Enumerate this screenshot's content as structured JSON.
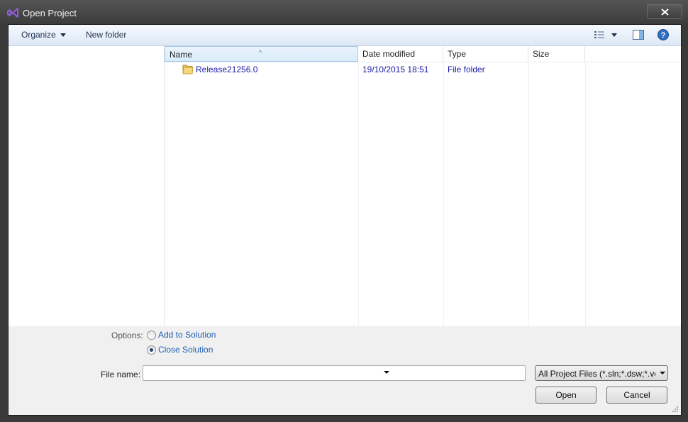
{
  "window": {
    "title": "Open Project",
    "accent": "#8855c8"
  },
  "toolbar": {
    "organize_label": "Organize",
    "new_folder_label": "New folder"
  },
  "columns": {
    "name": "Name",
    "date_modified": "Date modified",
    "type": "Type",
    "size": "Size"
  },
  "files": [
    {
      "name": "Release21256.0",
      "date_modified": "19/10/2015 18:51",
      "type": "File folder",
      "size": ""
    }
  ],
  "options": {
    "label": "Options:",
    "add_to_solution": "Add to Solution",
    "close_solution": "Close Solution",
    "selected": "close_solution"
  },
  "file_name": {
    "label": "File name:",
    "value": ""
  },
  "filter": {
    "selected": "All Project Files (*.sln;*.dsw;*.vcw;*.vcproj)"
  },
  "buttons": {
    "open": "Open",
    "cancel": "Cancel"
  }
}
